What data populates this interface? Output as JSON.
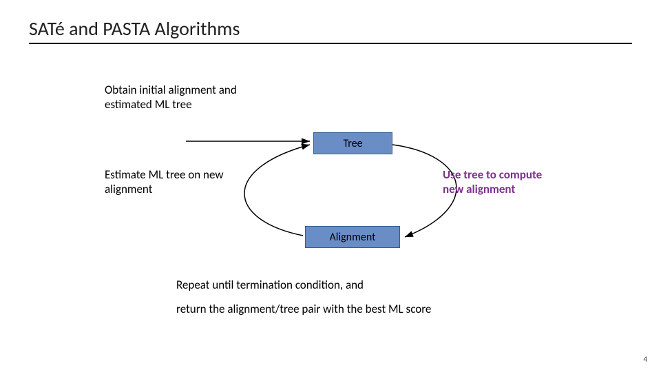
{
  "title": "SATé and PASTA Algorithms",
  "intro_line1": "Obtain initial alignment and",
  "intro_line2": "estimated ML tree",
  "box_tree": "Tree",
  "box_alignment": "Alignment",
  "left_line1": "Estimate ML tree on new",
  "left_line2": "alignment",
  "right_line1": "Use tree to compute",
  "right_line2": "new alignment",
  "repeat_text": "Repeat until termination condition, and",
  "return_text": "return the alignment/tree pair with the best ML score",
  "page_number": "4"
}
